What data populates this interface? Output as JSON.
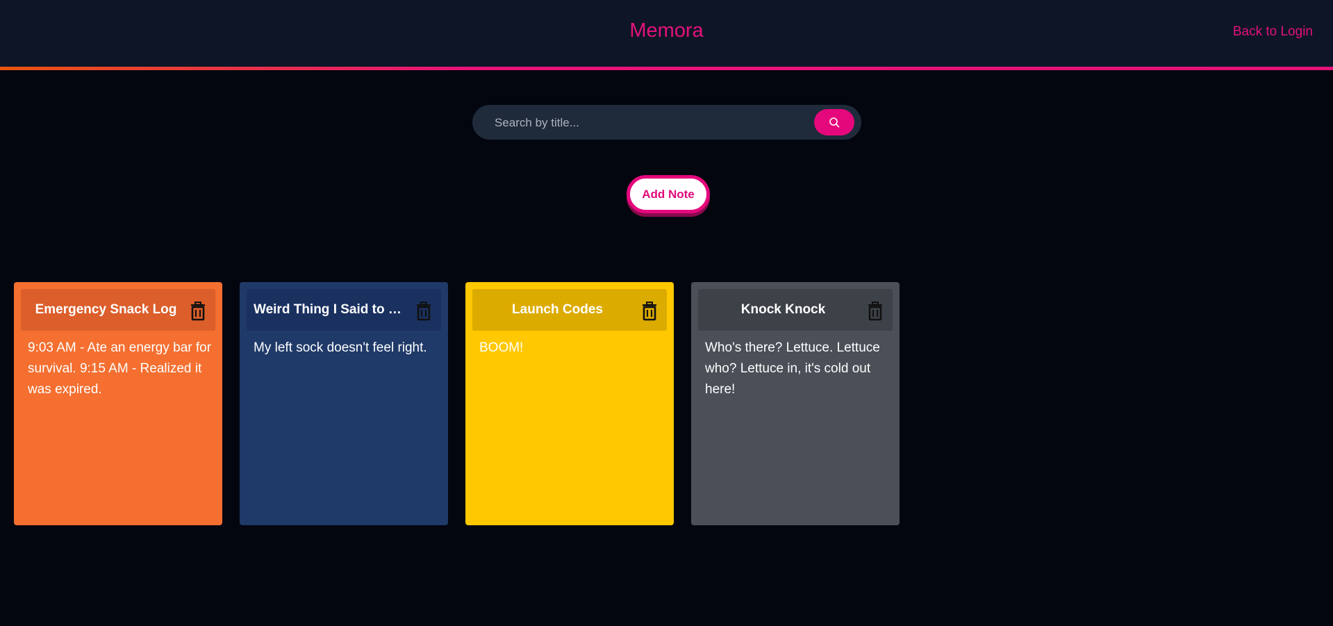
{
  "header": {
    "brand": "Memora",
    "back_link": "Back to Login",
    "accent_color": "#e3127b"
  },
  "search": {
    "placeholder": "Search by title...",
    "value": "",
    "button_icon": "search-icon"
  },
  "add_note": {
    "label": "Add Note"
  },
  "notes": [
    {
      "title": "Emergency Snack Log",
      "body": "9:03 AM - Ate an energy bar for survival. 9:15 AM - Realized it was expired.",
      "color": "#f46f30",
      "header_color": "#dc5e2b",
      "icon": "trash-icon"
    },
    {
      "title": "Weird Thing I Said to My ...",
      "body": "My left sock doesn't feel right.",
      "color": "#1f3a68",
      "header_color": "#1a3160",
      "icon": "trash-icon"
    },
    {
      "title": "Launch Codes",
      "body": "BOOM!",
      "color": "#ffc800",
      "header_color": "#dcab00",
      "icon": "trash-icon"
    },
    {
      "title": "Knock Knock",
      "body": "Who's there? Lettuce. Lettuce who? Lettuce in, it's cold out here!",
      "color": "#4a4f58",
      "header_color": "#3d4148",
      "icon": "trash-icon"
    }
  ]
}
